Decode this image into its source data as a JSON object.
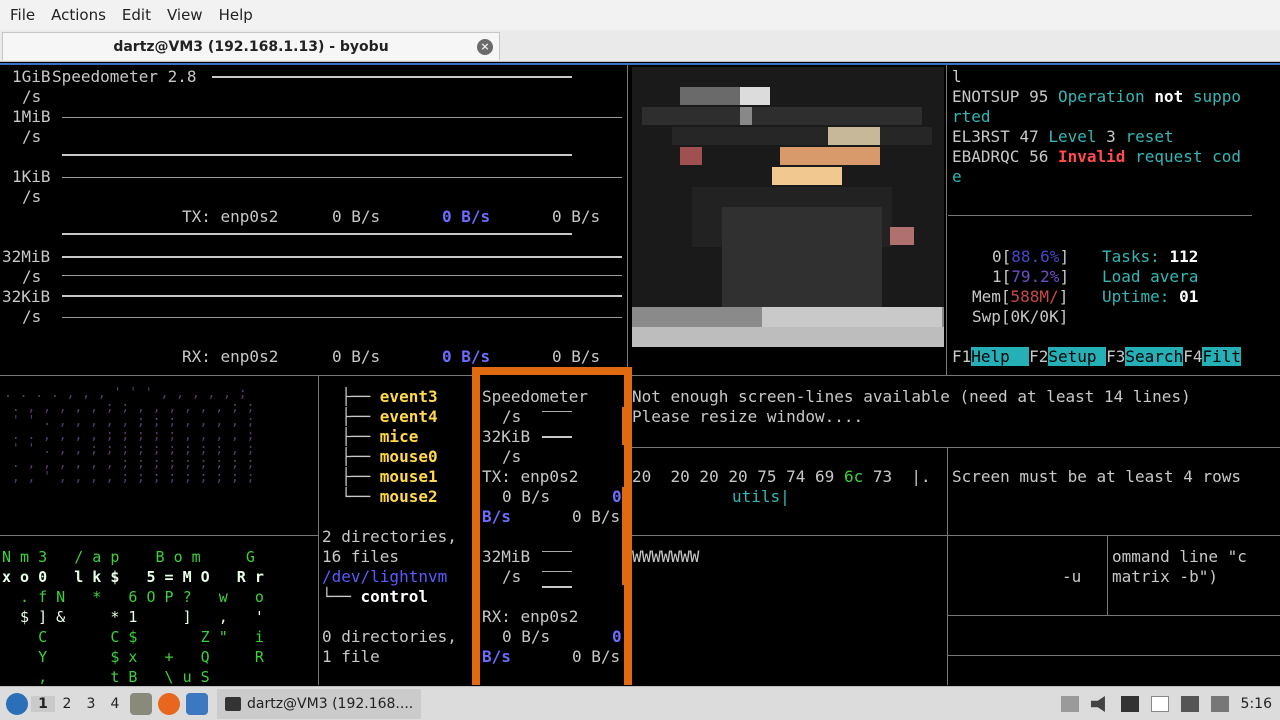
{
  "menubar": {
    "items": [
      "File",
      "Actions",
      "Edit",
      "View",
      "Help"
    ]
  },
  "tab": {
    "title": "dartz@VM3 (192.168.1.13) - byobu",
    "close": "×"
  },
  "speedometer": {
    "title": "Speedometer 2.8",
    "y1": "1GiB",
    "unit": "/s",
    "y2": "1MiB",
    "y3": "1KiB",
    "y4": "32MiB",
    "y5": "32KiB",
    "tx_label": "TX: enp0s2",
    "tx_vals": [
      "0 B/s",
      "0 B/s",
      "0 B/s"
    ],
    "rx_label": "RX: enp0s2",
    "rx_vals": [
      "0 B/s",
      "0 B/s",
      "0 B/s"
    ]
  },
  "errno": {
    "line0": "l",
    "l1_name": "ENOTSUP",
    "l1_num": "95",
    "l1_a": "Operation",
    "l1_b": "not",
    "l1_c": "suppo",
    "l2": "rted",
    "l3_name": "EL3RST",
    "l3_num": "47",
    "l3_a": "Level",
    "l3_n": "3",
    "l3_b": "reset",
    "l4_name": "EBADRQC",
    "l4_num": "56",
    "l4_a": "Invalid",
    "l4_b": "request cod",
    "l5": "e"
  },
  "htop": {
    "cpu0_label": "0[",
    "cpu0_val": "88.6%",
    "cpu1_label": "1[",
    "cpu1_val": "79.2%",
    "mem_label": "Mem[",
    "mem_val": "588M/",
    "swp_label": "Swp[",
    "swp_val": "0K/0K",
    "tasks_label": "Tasks:",
    "tasks_val": "112",
    "load_label": "Load avera",
    "uptime_label": "Uptime:",
    "uptime_val": "01",
    "fkeys": [
      {
        "k": "F1",
        "l": "Help  "
      },
      {
        "k": "F2",
        "l": "Setup "
      },
      {
        "k": "F3",
        "l": "Search"
      },
      {
        "k": "F4",
        "l": "Filt"
      }
    ]
  },
  "tree": {
    "items": [
      "event3",
      "event4",
      "mice",
      "mouse0",
      "mouse1",
      "mouse2"
    ],
    "summary1a": "2 directories,",
    "summary1b": "16 files",
    "path": "/dev/lightnvm",
    "child": "control",
    "summary2a": "0 directories,",
    "summary2b": "1 file"
  },
  "mini_speedo": {
    "title": "Speedometer",
    "unit": "/s",
    "y1": "32KiB",
    "tx_label": "TX: enp0s2",
    "tx_a": "0 B/s",
    "tx_b": "0",
    "tx_c": "B/s",
    "tx_d": "0 B/s",
    "y2": "32MiB",
    "rx_label": "RX: enp0s2",
    "rx_a": "0 B/s",
    "rx_b": "0",
    "rx_c": "B/s",
    "rx_d": "0 B/s"
  },
  "messages": {
    "m1": "Not enough screen-lines available (need at least 14 lines)",
    "m2": "Please resize window....",
    "hex": "20  20 20 20 75 74 69",
    "hex_hi": "6c",
    "hex_end": "73  |.",
    "hex2": "utils|",
    "rows": "Screen must be at least 4 rows",
    "w": "WWWWWWW",
    "cmd1": "ommand line \"c",
    "cmd2": "matrix -b\")",
    "flag": "-u"
  },
  "matrix_rows": [
    "N m 3   / a p    B o m     G",
    "x o 0   l k $   5 = M O   R r",
    "  . f N   *   6 O P ?   w   o",
    "  $ ] &     * 1     ]   ,   '",
    "    C       C $       Z \"   i",
    "    Y       $ x   +   Q     R",
    "    ,       t B   \\ u S"
  ],
  "taskbar": {
    "workspaces": [
      "1",
      "2",
      "3",
      "4"
    ],
    "app": "dartz@VM3 (192.168....",
    "clock": "5:16"
  },
  "colors": {
    "accent": "#3a6fc4",
    "orange": "#e06a10",
    "teal": "#25b0b8"
  }
}
